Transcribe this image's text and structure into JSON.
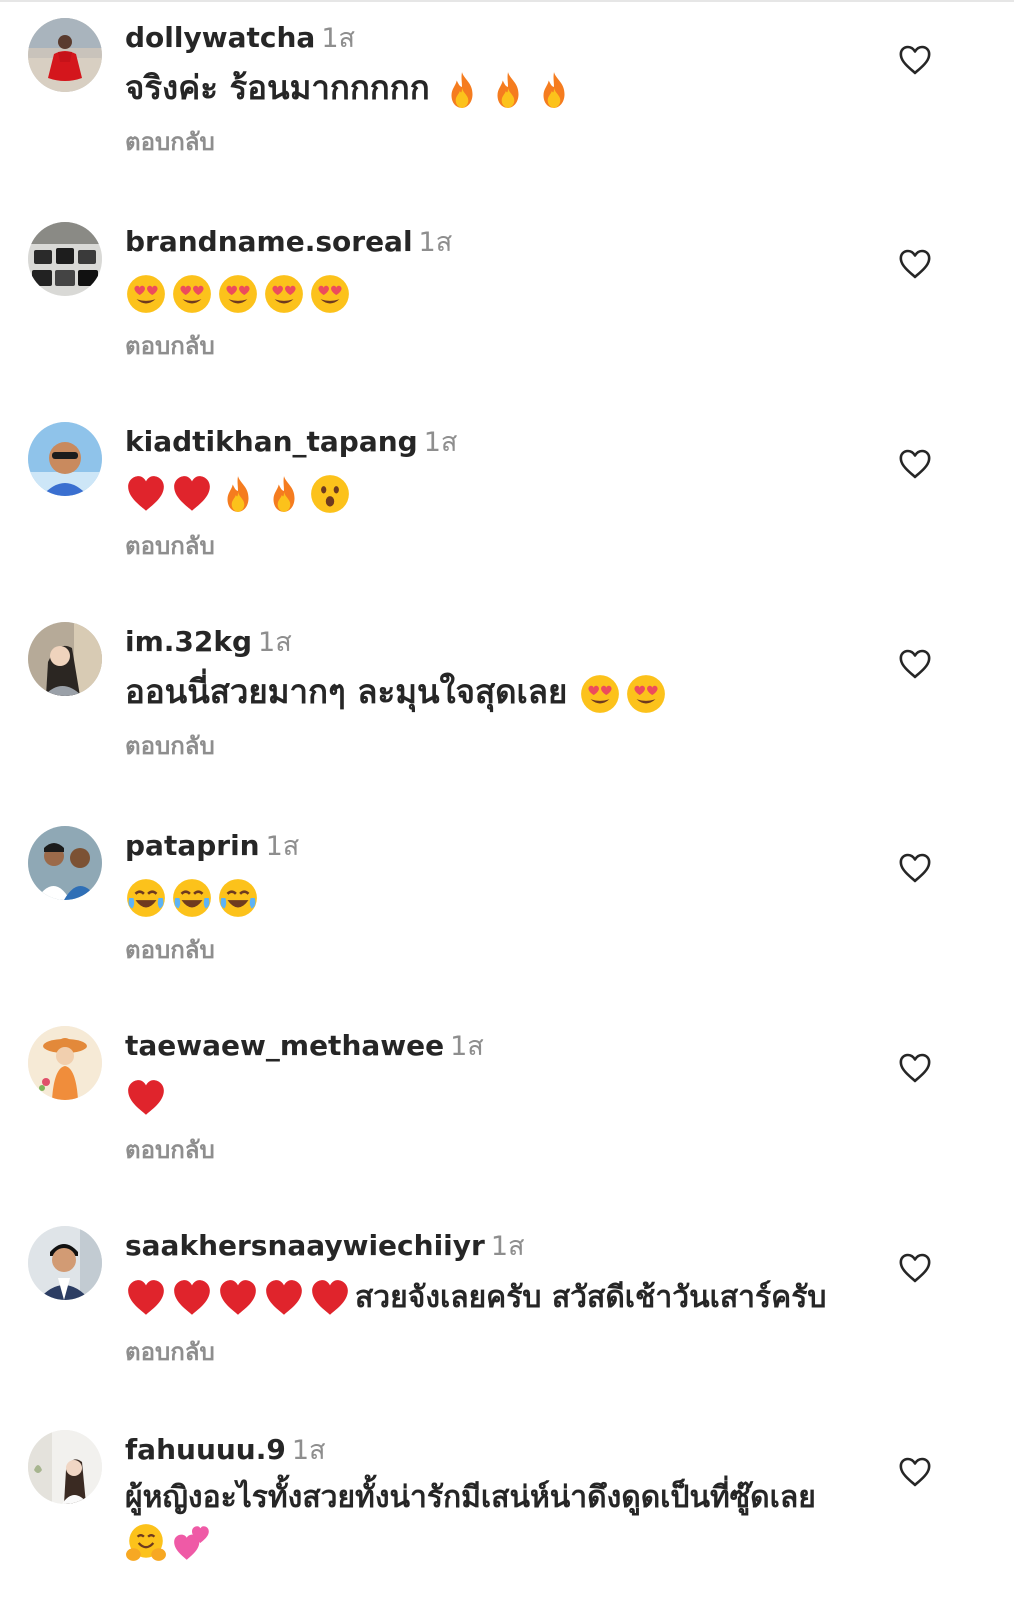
{
  "comments": [
    {
      "username": "dollywatcha",
      "time": "1ส",
      "text": "จริงค่ะ ร้อนมากกกกก",
      "emojis": [
        "fire",
        "fire",
        "fire"
      ],
      "reply_label": "ตอบกลับ",
      "avatar": "woman-red-dress-beach"
    },
    {
      "username": "brandname.soreal",
      "time": "1ส",
      "text": "",
      "emojis": [
        "heart-eyes",
        "heart-eyes",
        "heart-eyes",
        "heart-eyes",
        "heart-eyes"
      ],
      "reply_label": "ตอบกลับ",
      "avatar": "handbags-shelf"
    },
    {
      "username": "kiadtikhan_tapang",
      "time": "1ส",
      "text": "",
      "emojis": [
        "red-heart",
        "red-heart",
        "fire",
        "fire",
        "surprised-face"
      ],
      "reply_label": "ตอบกลับ",
      "avatar": "man-sunglasses-sky"
    },
    {
      "username": "im.32kg",
      "time": "1ส",
      "text": "ออนนี่สวยมากๆ ละมุนใจสุดเลย",
      "emojis": [
        "heart-eyes",
        "heart-eyes"
      ],
      "reply_label": "ตอบกลับ",
      "avatar": "woman-selfie"
    },
    {
      "username": "pataprin",
      "time": "1ส",
      "text": "",
      "emojis": [
        "tears-of-joy",
        "tears-of-joy",
        "tears-of-joy"
      ],
      "reply_label": "ตอบกลับ",
      "avatar": "two-people"
    },
    {
      "username": "taewaew_methawee",
      "time": "1ส",
      "text": "",
      "emojis": [
        "red-heart"
      ],
      "reply_label": "ตอบกลับ",
      "avatar": "illustrated-girl-hat"
    },
    {
      "username": "saakhersnaaywiechiiyr",
      "time": "1ส",
      "text": "สวยจังเลยครับ สวัสดีเช้าวันเสาร์ครับ",
      "emojis": [
        "red-heart",
        "red-heart",
        "red-heart",
        "red-heart",
        "red-heart"
      ],
      "emoji_position": "before",
      "reply_label": "ตอบกลับ",
      "avatar": "older-man-suit"
    },
    {
      "username": "fahuuuu.9",
      "time": "1ส",
      "text": "ผู้หญิงอะไรทั้งสวยทั้งน่ารักมีเสน่ห์น่าดึงดูดเป็นที่ซู๊ดเลย",
      "emojis": [
        "hugging-face",
        "two-hearts"
      ],
      "emoji_position": "newline",
      "reply_label": "",
      "avatar": "woman-white-room"
    }
  ],
  "icons": {
    "like": "heart-outline-icon"
  },
  "colors": {
    "text": "#262626",
    "muted": "#8e8e8e",
    "heart_red": "#e0242c",
    "emoji_yellow": "#fcc21b"
  }
}
